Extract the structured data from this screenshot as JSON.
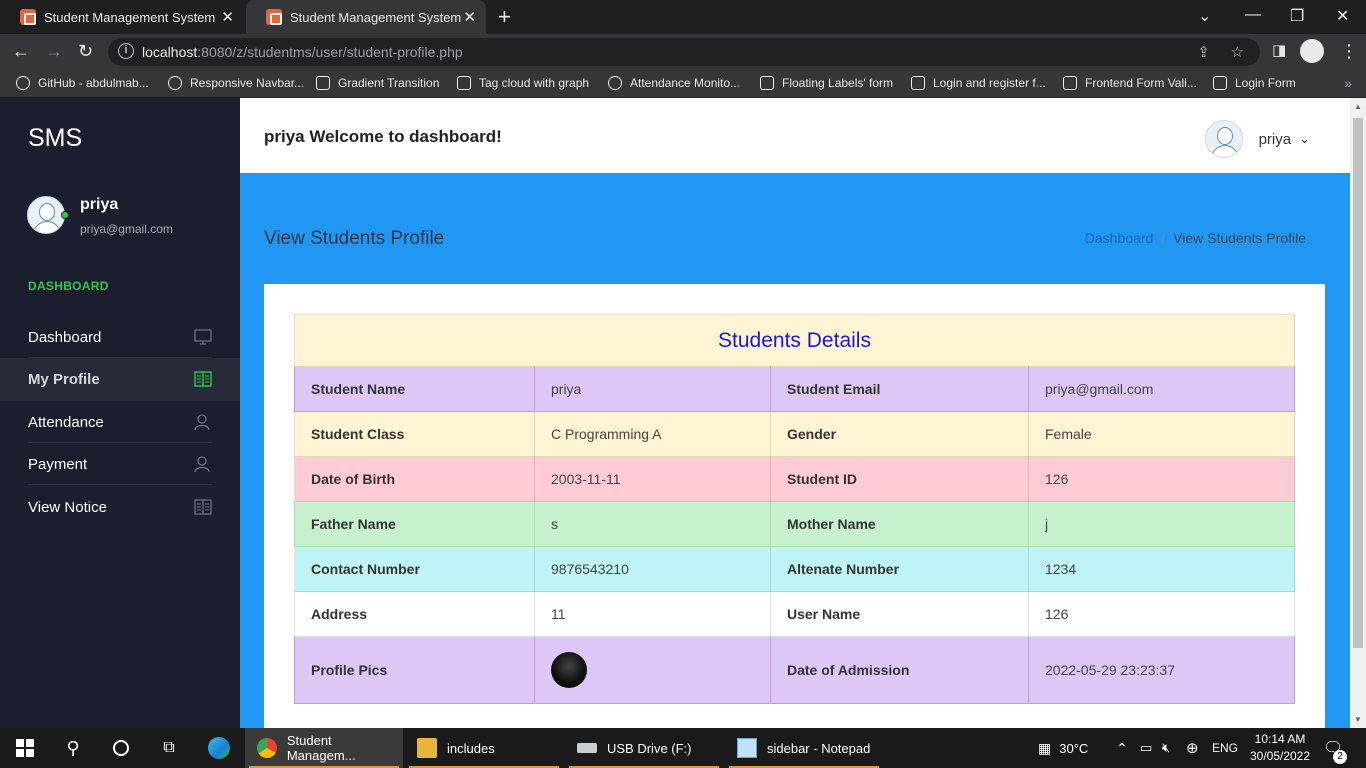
{
  "browser": {
    "tabs": [
      {
        "title": "Student Management System|||Dashboard",
        "active": false
      },
      {
        "title": "Student Management System|| View Students Profile",
        "active": true
      }
    ],
    "url_host": "localhost",
    "url_rest": ":8080/z/studentms/user/student-profile.php",
    "bookmarks": [
      "GitHub - abdulmab...",
      "Responsive Navbar...",
      "Gradient Transition",
      "Tag cloud with graph",
      "Attendance Monito...",
      "Floating Labels' form",
      "Login and register f...",
      "Frontend Form Vali...",
      "Login Form"
    ]
  },
  "sidebar": {
    "brand": "SMS",
    "user_name": "priya",
    "user_email": "priya@gmail.com",
    "section_title": "DASHBOARD",
    "items": [
      {
        "label": "Dashboard",
        "icon": "monitor-icon",
        "active": false
      },
      {
        "label": "My Profile",
        "icon": "book-icon",
        "active": true
      },
      {
        "label": "Attendance",
        "icon": "user-icon",
        "active": false
      },
      {
        "label": "Payment",
        "icon": "user-icon",
        "active": false
      },
      {
        "label": "View Notice",
        "icon": "book-icon",
        "active": false
      }
    ]
  },
  "header": {
    "welcome": "priya Welcome to dashboard!",
    "user_label": "priya"
  },
  "page": {
    "title": "View Students Profile",
    "breadcrumb_home": "Dashboard",
    "breadcrumb_current": "View Students Profile"
  },
  "details": {
    "heading": "Students Details",
    "rows": [
      {
        "k1": "Student Name",
        "v1": "priya",
        "k2": "Student Email",
        "v2": "priya@gmail.com",
        "color": "purple"
      },
      {
        "k1": "Student Class",
        "v1": "C Programming A",
        "k2": "Gender",
        "v2": "Female",
        "color": "yellow"
      },
      {
        "k1": "Date of Birth",
        "v1": "2003-11-11",
        "k2": "Student ID",
        "v2": "126",
        "color": "red"
      },
      {
        "k1": "Father Name",
        "v1": "s",
        "k2": "Mother Name",
        "v2": "j",
        "color": "green"
      },
      {
        "k1": "Contact Number",
        "v1": "9876543210",
        "k2": "Altenate Number",
        "v2": "1234",
        "color": "cyan"
      },
      {
        "k1": "Address",
        "v1": "11",
        "k2": "User Name",
        "v2": "126",
        "color": "white"
      }
    ],
    "last_row": {
      "k1": "Profile Pics",
      "k2": "Date of Admission",
      "v2": "2022-05-29 23:23:37"
    }
  },
  "taskbar": {
    "apps": [
      {
        "label": "Student Managem...",
        "icon": "chrome-icon"
      },
      {
        "label": "includes",
        "icon": "folder-icon"
      },
      {
        "label": "USB Drive (F:)",
        "icon": "drive-icon"
      },
      {
        "label": "sidebar - Notepad",
        "icon": "notepad-icon"
      }
    ],
    "temperature": "30°C",
    "language": "ENG",
    "time": "10:14 AM",
    "date": "30/05/2022",
    "notification_count": "2"
  },
  "colors": {
    "sidebar_bg": "#1b1e2e",
    "accent_green": "#2ecc40",
    "header_blue": "#2196f3",
    "heading_blue": "#1a1acd"
  }
}
